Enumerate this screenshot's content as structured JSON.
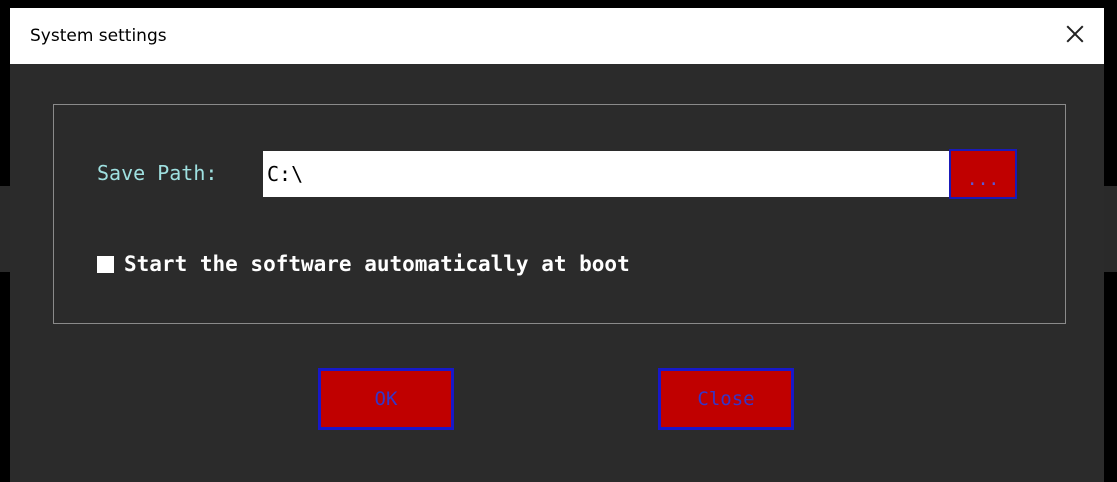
{
  "window": {
    "title": "System settings"
  },
  "settings": {
    "save_path_label": "Save Path:",
    "save_path_value": "C:\\",
    "browse_label": "...",
    "autostart_label": "Start the software automatically at boot",
    "autostart_checked": false
  },
  "footer": {
    "ok_label": "OK",
    "close_label": "Close"
  },
  "colors": {
    "dialog_bg": "#2b2b2b",
    "button_bg": "#c00000",
    "button_border": "#1818c8",
    "label_cyan": "#9fe0e0"
  },
  "icons": {
    "close": "close-icon",
    "checkbox": "checkbox-icon"
  }
}
